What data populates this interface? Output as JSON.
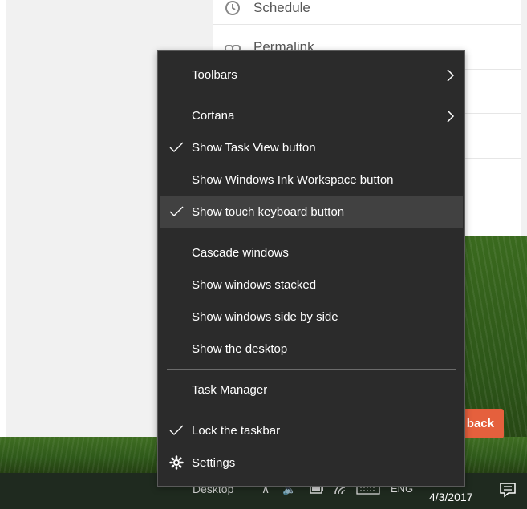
{
  "background_app": {
    "rows": [
      {
        "label": "Schedule",
        "icon": "clock-icon"
      },
      {
        "label": "Permalink",
        "icon": "link-icon"
      }
    ],
    "feedback_button_label": "back"
  },
  "taskbar": {
    "desktop_label": "Desktop",
    "language": "ENG",
    "date": "4/3/2017"
  },
  "context_menu": {
    "toolbars": "Toolbars",
    "cortana": "Cortana",
    "show_task_view": "Show Task View button",
    "show_ink_workspace": "Show Windows Ink Workspace button",
    "show_touch_keyboard": "Show touch keyboard button",
    "cascade_windows": "Cascade windows",
    "show_stacked": "Show windows stacked",
    "show_side_by_side": "Show windows side by side",
    "show_desktop": "Show the desktop",
    "task_manager": "Task Manager",
    "lock_taskbar": "Lock the taskbar",
    "settings": "Settings"
  },
  "colors": {
    "menu_bg": "#2b2b2b",
    "menu_highlight": "#414141",
    "accent_feedback": "#e5603d"
  }
}
